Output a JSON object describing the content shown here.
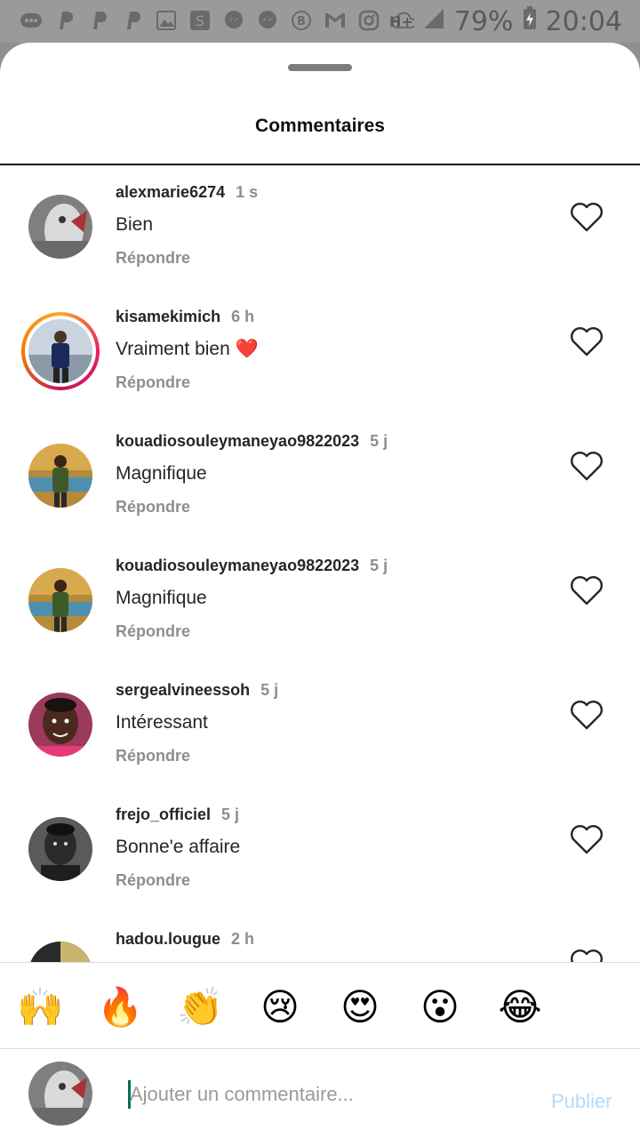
{
  "status_bar": {
    "battery": "79%",
    "time": "20:04",
    "network": "H+",
    "icons": [
      "chat-bubble-icon",
      "paypal-icon",
      "paypal-icon",
      "paypal-icon",
      "gallery-icon",
      "s-app-icon",
      "messenger-icon",
      "messenger-icon",
      "b-circle-icon",
      "gmail-icon",
      "instagram-icon",
      "cloud-icon"
    ]
  },
  "sheet": {
    "title": "Commentaires"
  },
  "comments": [
    {
      "username": "alexmarie6274",
      "time": "1 s",
      "text": "Bien",
      "reply": "Répondre"
    },
    {
      "username": "kisamekimich",
      "time": "6 h",
      "text": "Vraiment bien ❤️",
      "reply": "Répondre"
    },
    {
      "username": "kouadiosouleymaneyao9822023",
      "time": "5 j",
      "text": "Magnifique",
      "reply": "Répondre"
    },
    {
      "username": "kouadiosouleymaneyao9822023",
      "time": "5 j",
      "text": "Magnifique",
      "reply": "Répondre"
    },
    {
      "username": "sergealvineessoh",
      "time": "5 j",
      "text": "Intéressant",
      "reply": "Répondre"
    },
    {
      "username": "frejo_officiel",
      "time": "5 j",
      "text": "Bonne'e affaire",
      "reply": "Répondre"
    },
    {
      "username": "hadou.lougue",
      "time": "2 h",
      "text": "",
      "reply": ""
    }
  ],
  "emoji_bar": [
    "🙌",
    "🔥",
    "👏",
    "😢",
    "😍",
    "😮",
    "😂"
  ],
  "composer": {
    "placeholder": "Ajouter un commentaire...",
    "publish_label": "Publier"
  },
  "colors": {
    "accent_disabled": "#b3dbff",
    "muted_text": "#8e8e8e",
    "story_ring": "#e91e63"
  }
}
